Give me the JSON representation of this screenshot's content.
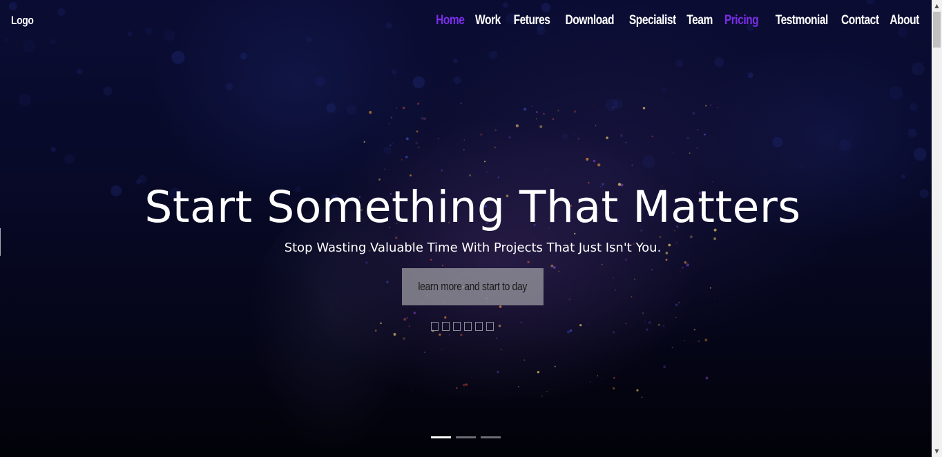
{
  "header": {
    "logo": "Logo"
  },
  "nav": {
    "items": [
      {
        "label": "Home",
        "active": true
      },
      {
        "label": "Work",
        "active": false
      },
      {
        "label": "Fetures",
        "active": false
      },
      {
        "label": "Download",
        "active": false
      },
      {
        "label": "Specialist",
        "active": false
      },
      {
        "label": "Team",
        "active": false
      },
      {
        "label": "Pricing",
        "active": true
      },
      {
        "label": "Testmonial",
        "active": false
      },
      {
        "label": "Contact",
        "active": false
      },
      {
        "label": "About",
        "active": false
      }
    ]
  },
  "hero": {
    "title": "Start Something That Matters",
    "subtitle": "Stop Wasting Valuable Time With Projects That Just Isn't You.",
    "cta_label": "learn more and start to day",
    "social_icons": [
      "social-icon-1",
      "social-icon-2",
      "social-icon-3",
      "social-icon-4",
      "social-icon-5",
      "social-icon-6"
    ]
  },
  "carousel": {
    "slide_count": 3,
    "active_slide": 1
  },
  "colors": {
    "accent": "#7a2ee6",
    "background": "#080a2a",
    "text": "#ffffff",
    "button_bg": "#a0a0a5"
  }
}
